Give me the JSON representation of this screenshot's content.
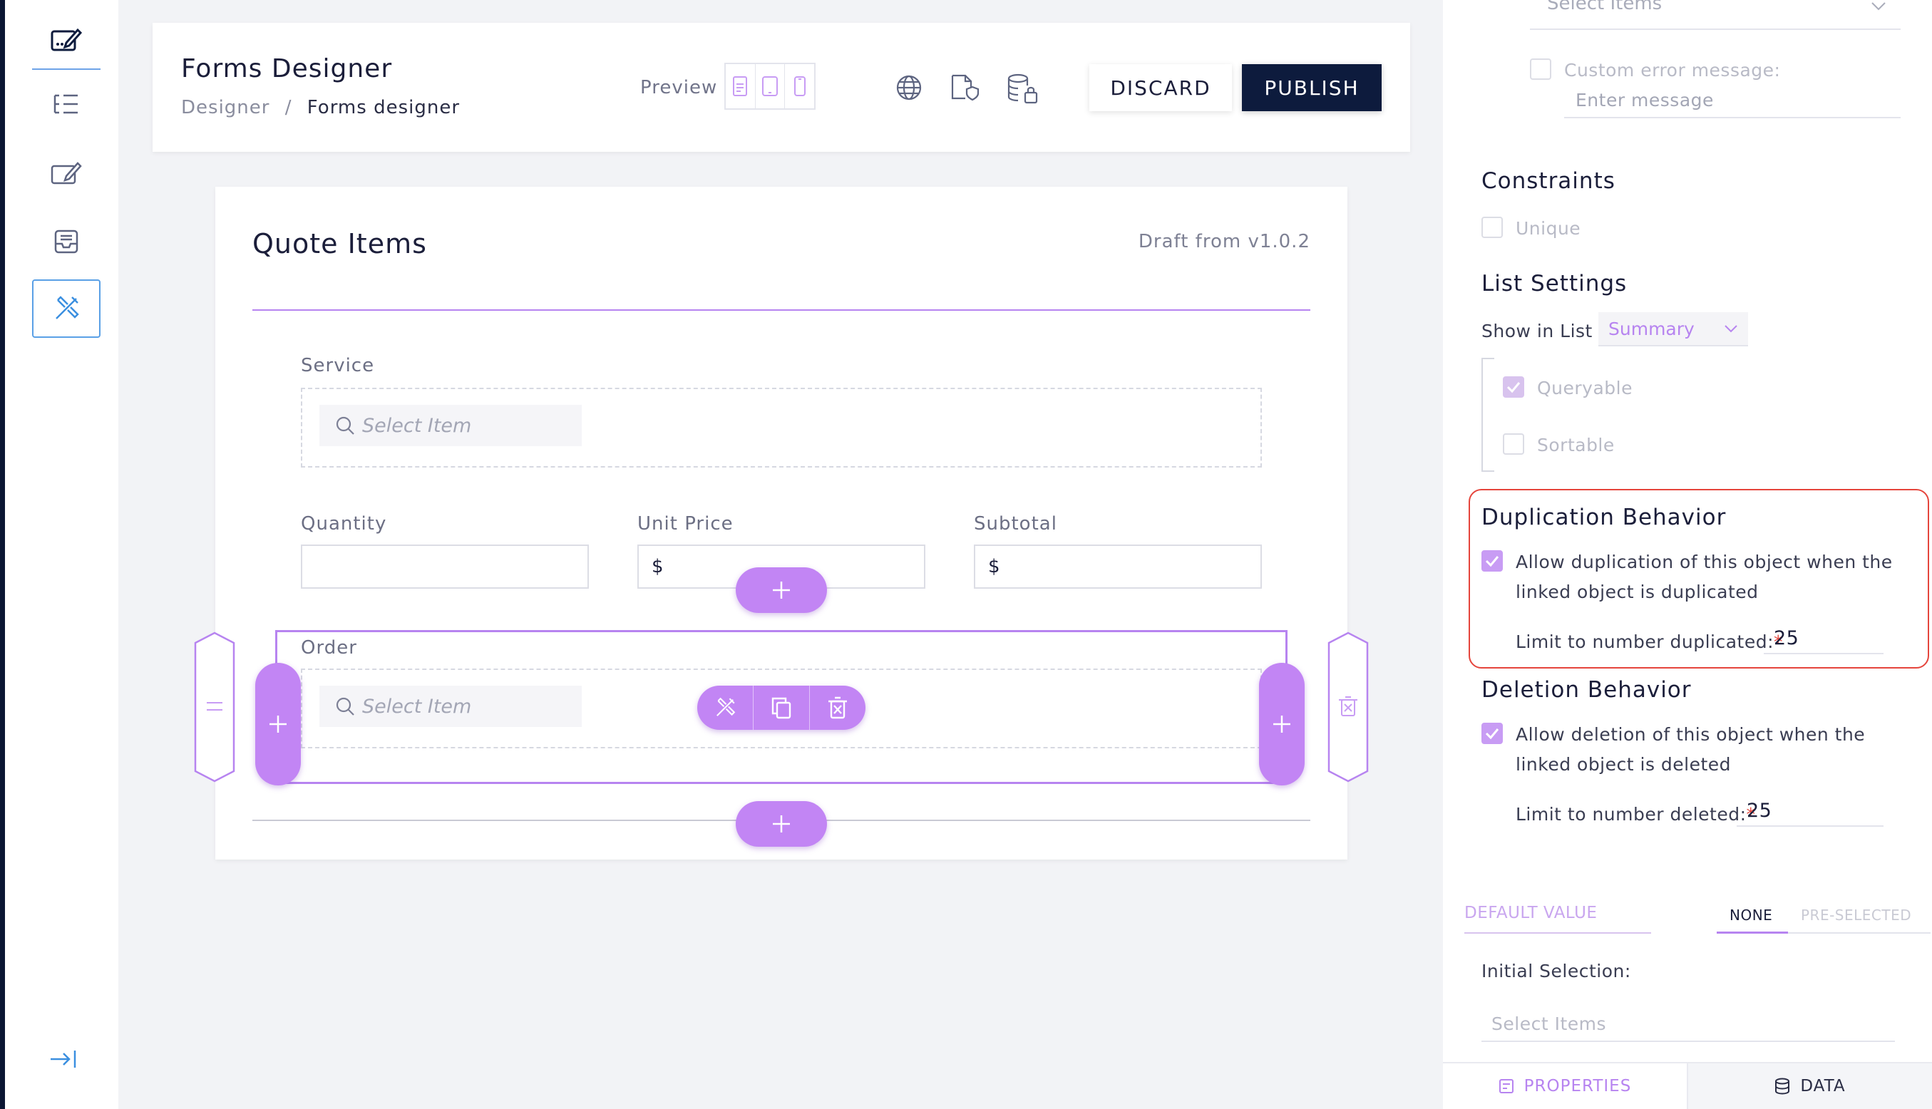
{
  "nav": {
    "items": [
      "forms-edit-icon",
      "tree-list-icon",
      "edit-icon",
      "inbox-icon",
      "design-tools-icon"
    ],
    "collapse_icon": "collapse-right-icon"
  },
  "header": {
    "title": "Forms Designer",
    "breadcrumb_root": "Designer",
    "breadcrumb_sep": "/",
    "breadcrumb_current": "Forms designer",
    "preview_label": "Preview",
    "discard_label": "DISCARD",
    "publish_label": "PUBLISH"
  },
  "form": {
    "title": "Quote Items",
    "draft": "Draft from v1.0.2",
    "service_label": "Service",
    "service_placeholder": "Select Item",
    "quantity_label": "Quantity",
    "unit_price_label": "Unit Price",
    "unit_price_value": "$",
    "subtotal_label": "Subtotal",
    "subtotal_value": "$",
    "order_label": "Order",
    "order_placeholder": "Select Item"
  },
  "panel": {
    "top_select_placeholder": "Select Items",
    "custom_error_label": "Custom error message:",
    "custom_error_placeholder": "Enter message",
    "constraints_title": "Constraints",
    "unique_label": "Unique",
    "list_settings_title": "List Settings",
    "show_in_list_label": "Show in List",
    "show_in_list_value": "Summary",
    "queryable_label": "Queryable",
    "sortable_label": "Sortable",
    "duplication_title": "Duplication Behavior",
    "duplication_text_1": "Allow duplication of this object when the",
    "duplication_text_2": "linked object is duplicated",
    "dup_limit_label": "Limit to number duplicated:",
    "dup_limit_required": "*",
    "dup_limit_value": "25",
    "deletion_title": "Deletion Behavior",
    "deletion_text_1": "Allow deletion of this object when the",
    "deletion_text_2": "linked object is deleted",
    "del_limit_label": "Limit to number deleted:",
    "del_limit_required": "*",
    "del_limit_value": "25",
    "default_value_label": "DEFAULT VALUE",
    "tab_none": "NONE",
    "tab_preselected": "PRE-SELECTED",
    "initial_selection_label": "Initial Selection:",
    "initial_selection_placeholder": "Select Items",
    "bottom_tab_properties": "PROPERTIES",
    "bottom_tab_data": "DATA"
  },
  "colors": {
    "accent_purple": "#c285f4",
    "navy": "#0d1b3d",
    "highlight_red": "#e5453c"
  }
}
